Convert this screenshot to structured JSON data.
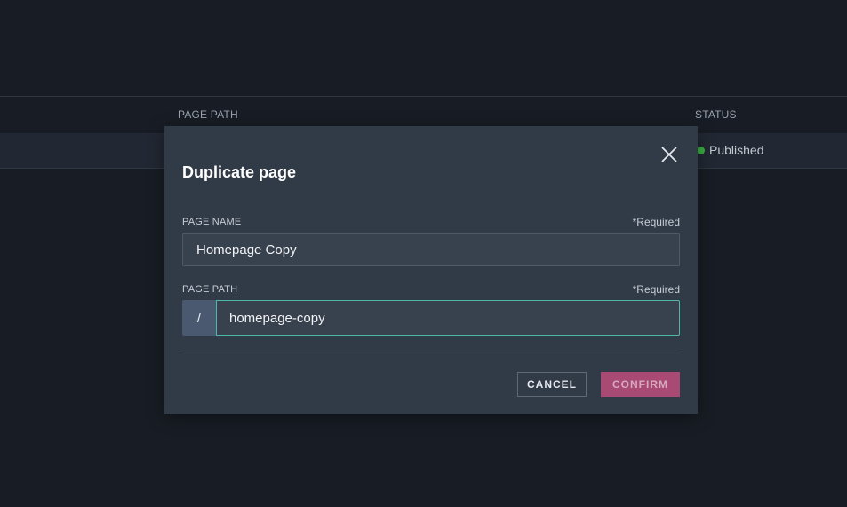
{
  "background_table": {
    "columns": [
      "PAGE PATH",
      "STATUS"
    ],
    "row": {
      "status": "Published"
    },
    "status_color": "#3bb143"
  },
  "modal": {
    "title": "Duplicate page",
    "close_icon": "close-icon",
    "page_name": {
      "label": "PAGE NAME",
      "required": "*Required",
      "value": "Homepage Copy"
    },
    "page_path": {
      "label": "PAGE PATH",
      "required": "*Required",
      "prefix": "/",
      "value": "homepage-copy"
    },
    "buttons": {
      "cancel": "CANCEL",
      "confirm": "CONFIRM"
    },
    "accent_color": "#a84a74",
    "focus_color": "#4fb7a8"
  }
}
